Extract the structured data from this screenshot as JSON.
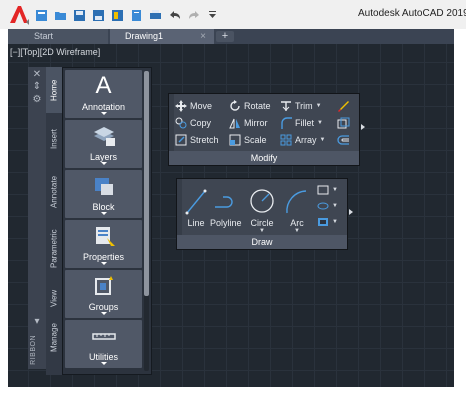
{
  "window": {
    "title": "Autodesk AutoCAD 2019"
  },
  "tabs": [
    {
      "label": "Start"
    },
    {
      "label": "Drawing1",
      "close": "×"
    }
  ],
  "tab_add": "+",
  "viewport": {
    "label": "[−][Top][2D Wireframe]"
  },
  "ribbon": {
    "strip_label": "RIBBON",
    "tabs": [
      "Home",
      "Insert",
      "Annotate",
      "Parametric",
      "View",
      "Manage"
    ],
    "panels": [
      "Annotation",
      "Layers",
      "Block",
      "Properties",
      "Groups",
      "Utilities"
    ]
  },
  "modify": {
    "title": "Modify",
    "tools": [
      "Move",
      "Rotate",
      "Trim",
      "Copy",
      "Mirror",
      "Fillet",
      "Stretch",
      "Scale",
      "Array"
    ]
  },
  "draw": {
    "title": "Draw",
    "tools": [
      "Line",
      "Polyline",
      "Circle",
      "Arc"
    ]
  },
  "colors": {
    "accent": "#e32626",
    "canvas": "#212830",
    "panel": "#3f4652"
  }
}
